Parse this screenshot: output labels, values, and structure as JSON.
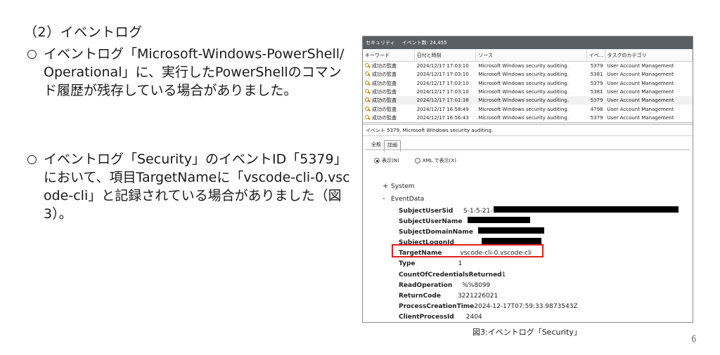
{
  "heading": "（2）イベントログ",
  "bullets": [
    {
      "mark": "○",
      "text": "イベントログ「Microsoft-Windows-PowerShell/Operational」に、実行したPowerShellのコマンド履歴が残存している場合がありました。"
    },
    {
      "mark": "○",
      "text": "イベントログ「Security」のイベントID「5379」において、項目TargetNameに「vscode-cli-0.vscode-cli」と記録されている場合がありました（図3）。"
    }
  ],
  "screenshot": {
    "log_name": "セキュリティ",
    "event_count": "イベント数: 24,455",
    "columns": [
      "キーワード",
      "日付と時刻",
      "ソース",
      "イベ...",
      "タスクのカテゴリ"
    ],
    "rows": [
      {
        "keyword": "成功の監査",
        "datetime": "2024/12/17 17:03:10",
        "source": "Microsoft Windows security auditing.",
        "id": "5379",
        "category": "User Account Management"
      },
      {
        "keyword": "成功の監査",
        "datetime": "2024/12/17 17:03:10",
        "source": "Microsoft Windows security auditing.",
        "id": "5381",
        "category": "User Account Management"
      },
      {
        "keyword": "成功の監査",
        "datetime": "2024/12/17 17:03:10",
        "source": "Microsoft Windows security auditing.",
        "id": "5379",
        "category": "User Account Management"
      },
      {
        "keyword": "成功の監査",
        "datetime": "2024/12/17 17:03:10",
        "source": "Microsoft Windows security auditing.",
        "id": "5381",
        "category": "User Account Management"
      },
      {
        "keyword": "成功の監査",
        "datetime": "2024/12/17 17:01:38",
        "source": "Microsoft Windows security auditing.",
        "id": "5379",
        "category": "User Account Management"
      },
      {
        "keyword": "成功の監査",
        "datetime": "2024/12/17 16:58:49",
        "source": "Microsoft Windows security auditing.",
        "id": "4798",
        "category": "User Account Management"
      },
      {
        "keyword": "成功の監査",
        "datetime": "2024/12/17 16:56:43",
        "source": "Microsoft Windows security auditing.",
        "id": "5379",
        "category": "User Account Management"
      }
    ],
    "event_title": "イベント 5379, Microsoft Windows security auditing.",
    "tabs": [
      "全般",
      "詳細"
    ],
    "active_tab": "詳細",
    "view_options": [
      "表示(N)",
      "XML で表示(X)"
    ],
    "selected_view": "表示(N)",
    "tree": [
      {
        "sign": "+",
        "label": "System"
      },
      {
        "sign": "-",
        "label": "EventData"
      }
    ],
    "fields": [
      {
        "name": "SubjectUserSid",
        "value": "S-1-5-21-"
      },
      {
        "name": "SubjectUserName",
        "value": ""
      },
      {
        "name": "SubjectDomainName",
        "value": ""
      },
      {
        "name": "SubjectLogonId",
        "value": ""
      },
      {
        "name": "TargetName",
        "value": "vscode-cli-0.vscode-cli"
      },
      {
        "name": "Type",
        "value": "1"
      },
      {
        "name": "CountOfCredentialsReturned",
        "value": "1"
      },
      {
        "name": "ReadOperation",
        "value": "%%8099"
      },
      {
        "name": "ReturnCode",
        "value": "3221226021"
      },
      {
        "name": "ProcessCreationTime",
        "value": "2024-12-17T07:59:33.9873543Z"
      },
      {
        "name": "ClientProcessId",
        "value": "2404"
      }
    ],
    "highlight_color": "#e0201a",
    "icon": "key-icon"
  },
  "caption": "図3:イベントログ「Security」",
  "page_number": "6"
}
